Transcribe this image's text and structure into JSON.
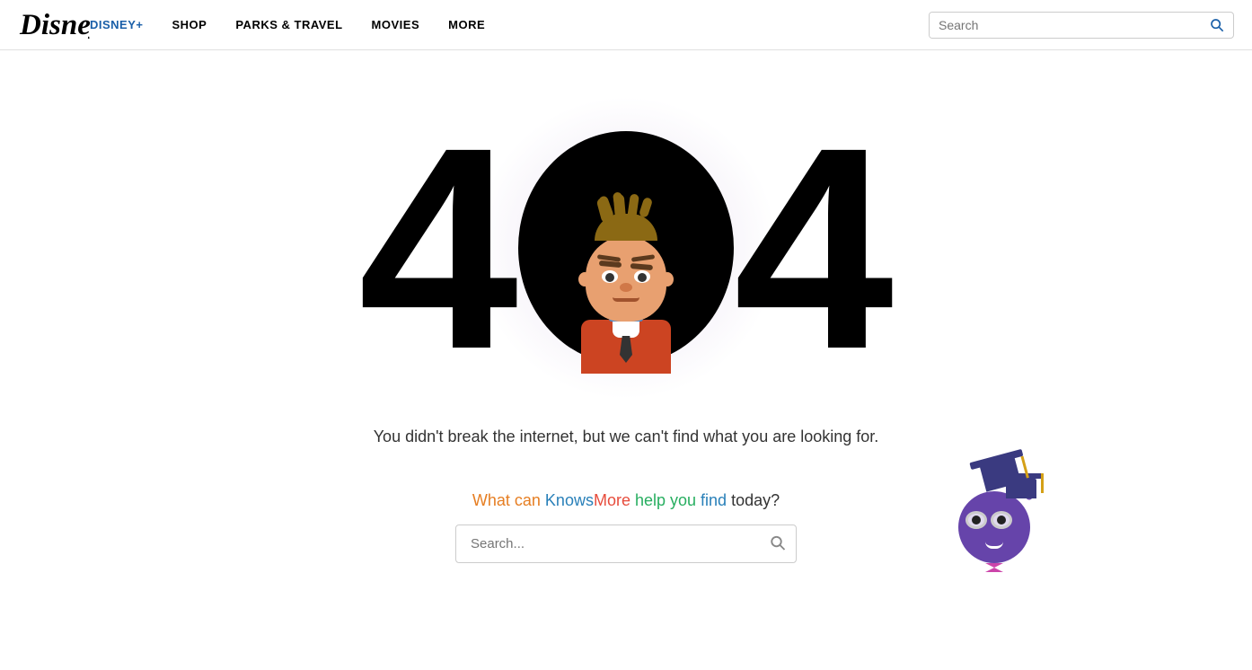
{
  "nav": {
    "logo": "Disney",
    "links": [
      {
        "id": "disney-plus",
        "label": "DISNEY+",
        "highlight": true
      },
      {
        "id": "shop",
        "label": "SHOP",
        "highlight": false
      },
      {
        "id": "parks-travel",
        "label": "PARKS & TRAVEL",
        "highlight": false
      },
      {
        "id": "movies",
        "label": "MOVIES",
        "highlight": false
      },
      {
        "id": "more",
        "label": "MORE",
        "highlight": false
      }
    ],
    "search_placeholder": "Search"
  },
  "error_page": {
    "code": "404",
    "message": "You didn't break the internet, but we can't find what you are looking for."
  },
  "knowsmore": {
    "prompt_what": "What can ",
    "prompt_knows": "Knows",
    "prompt_more": "More",
    "prompt_help": " help you ",
    "prompt_find": "find",
    "prompt_today": " today?",
    "search_placeholder": "Search..."
  }
}
